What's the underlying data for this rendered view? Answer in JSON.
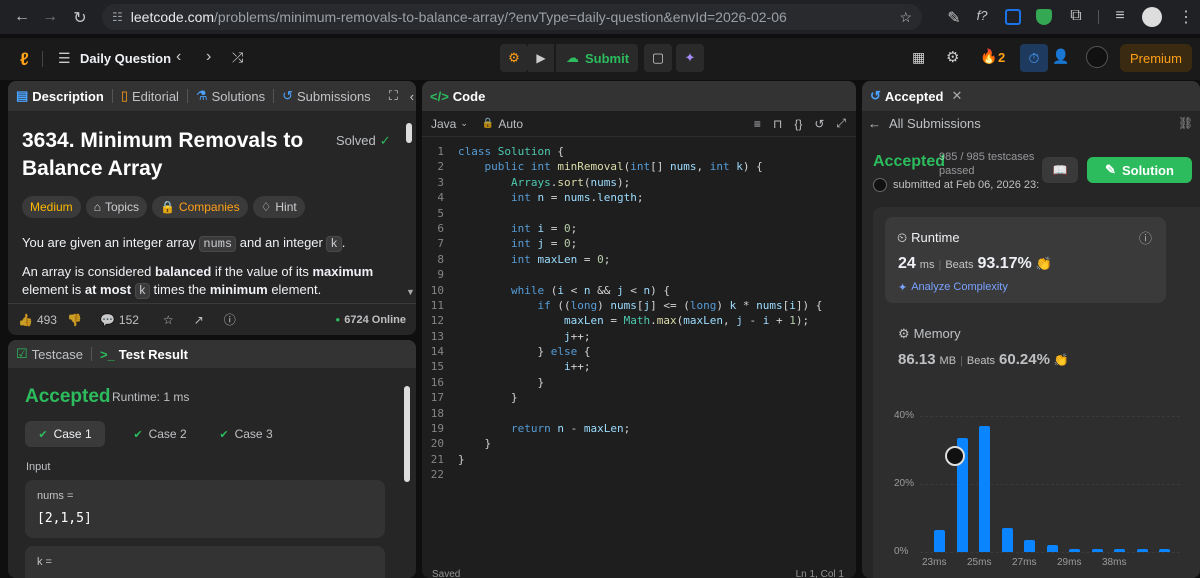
{
  "browser": {
    "url_host": "leetcode.com",
    "url_path": "/problems/minimum-removals-to-balance-array/?envType=daily-question&envId=2026-02-06"
  },
  "nav": {
    "daily_label": "Daily Question",
    "submit_label": "Submit",
    "streak": "2",
    "premium_label": "Premium"
  },
  "left": {
    "tabs": [
      "Description",
      "Editorial",
      "Solutions",
      "Submissions"
    ],
    "title_line1": "3634. Minimum Removals to",
    "title_line2": "Balance Array",
    "solved_label": "Solved",
    "difficulty": "Medium",
    "topics_label": "Topics",
    "companies_label": "Companies",
    "hint_label": "Hint",
    "p1_a": "You are given an integer array ",
    "p1_code1": "nums",
    "p1_b": " and an integer ",
    "p1_code2": "k",
    "p1_c": ".",
    "p2_a": "An array is considered ",
    "p2_b": "balanced",
    "p2_c": " if the value of its ",
    "p2_d": "maximum",
    "p2_e": "element is ",
    "p2_f": "at most",
    "p2_g": " ",
    "p2_code": "k",
    "p2_h": " times the ",
    "p2_i": "minimum",
    "p2_j": " element.",
    "likes": "493",
    "comments": "152",
    "online": "6724 Online"
  },
  "testpanel": {
    "tab_testcase": "Testcase",
    "tab_result": "Test Result",
    "status": "Accepted",
    "runtime": "Runtime: 1 ms",
    "cases": [
      "Case 1",
      "Case 2",
      "Case 3"
    ],
    "input_label": "Input",
    "nums_label": "nums =",
    "nums_value": "[2,1,5]",
    "k_label": "k ="
  },
  "code": {
    "header": "Code",
    "language": "Java",
    "mode": "Auto",
    "status_left": "Saved",
    "status_right": "Ln 1, Col 1",
    "lines": [
      "class Solution {",
      "    public int minRemoval(int[] nums, int k) {",
      "        Arrays.sort(nums);",
      "        int n = nums.length;",
      "",
      "        int i = 0;",
      "        int j = 0;",
      "        int maxLen = 0;",
      "",
      "        while (i < n && j < n) {",
      "            if ((long) nums[j] <= (long) k * nums[i]) {",
      "                maxLen = Math.max(maxLen, j - i + 1);",
      "                j++;",
      "            } else {",
      "                i++;",
      "            }",
      "        }",
      "",
      "        return n - maxLen;",
      "    }",
      "}",
      ""
    ]
  },
  "result": {
    "tab_label": "Accepted",
    "all_submissions": "All Submissions",
    "status": "Accepted",
    "testcases": "985 / 985 testcases",
    "passed": "passed",
    "submitted": "submitted at Feb 06, 2026 23:",
    "solution_label": "Solution",
    "runtime_label": "Runtime",
    "runtime_value": "24",
    "runtime_unit": "ms",
    "beats_label": "Beats",
    "runtime_beats": "93.17%",
    "analyze_label": "Analyze Complexity",
    "memory_label": "Memory",
    "memory_value": "86.13",
    "memory_unit": "MB",
    "memory_beats": "60.24%"
  },
  "chart_data": {
    "type": "bar",
    "yticks": [
      "40%",
      "20%",
      "0%"
    ],
    "xticks": [
      "23ms",
      "25ms",
      "27ms",
      "29ms",
      "38ms"
    ],
    "ylim": [
      0,
      0.4
    ],
    "values": [
      0.065,
      0.335,
      0.37,
      0.07,
      0.035,
      0.02,
      0.01,
      0.01,
      0.01,
      0.01,
      0.01
    ]
  },
  "colors": {
    "accent_green": "#2cbb5d",
    "accent_orange": "#ffa116",
    "medium": "#ffb800",
    "bar": "#0a84ff"
  }
}
